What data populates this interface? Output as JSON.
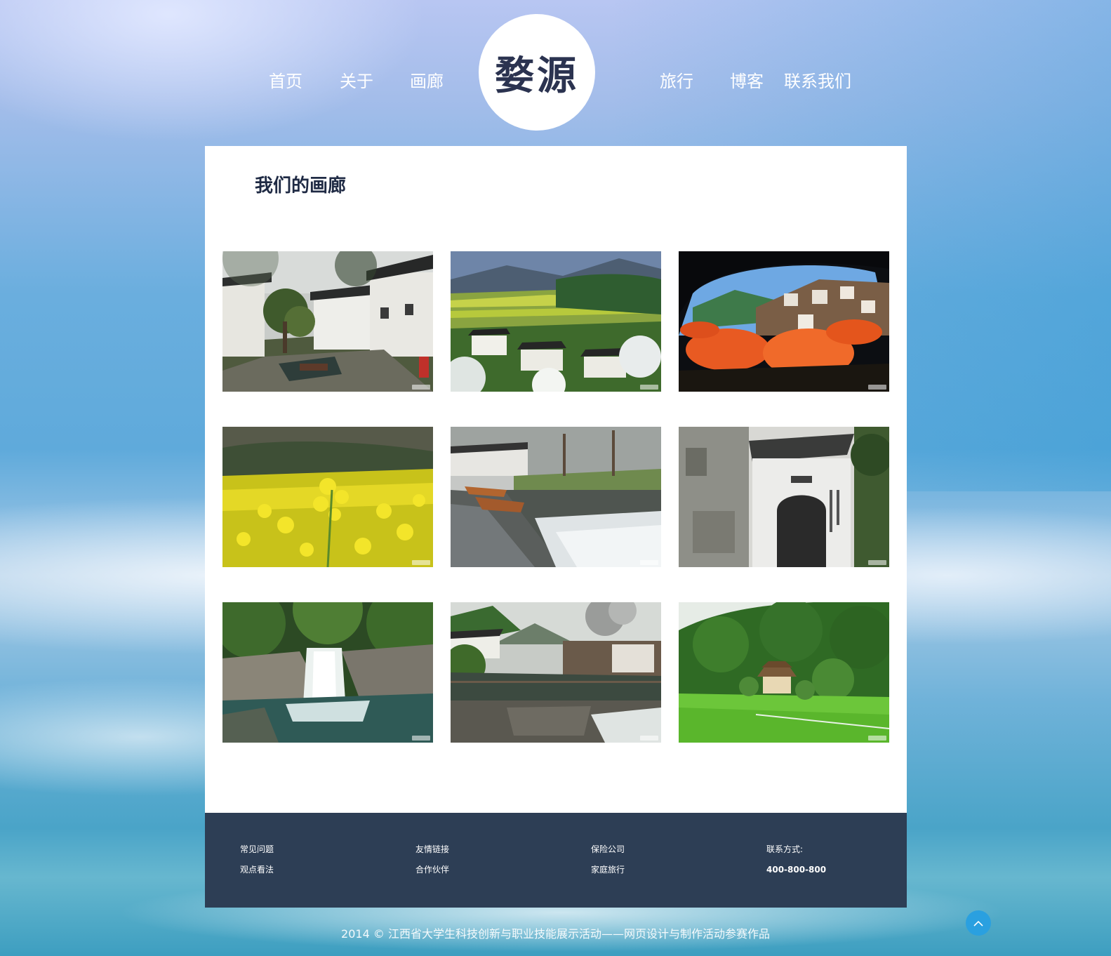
{
  "header": {
    "nav_left": [
      "首页",
      "关于",
      "画廊"
    ],
    "logo": "婺源",
    "nav_right": [
      "旅行",
      "博客",
      "联系我们"
    ]
  },
  "main": {
    "title": "我们的画廊",
    "photos": [
      "village-street-photo",
      "terraced-fields-photo",
      "drying-chili-baskets-photo",
      "rapeseed-flowers-photo",
      "river-boats-photo",
      "ancient-gate-photo",
      "waterfall-photo",
      "riverside-village-photo",
      "mountain-temple-photo"
    ]
  },
  "footer": {
    "col1": [
      "常见问题",
      "观点看法"
    ],
    "col2": [
      "友情链接",
      "合作伙伴"
    ],
    "col3": [
      "保险公司",
      "家庭旅行"
    ],
    "contact_label": "联系方式:",
    "phone": "400-800-800"
  },
  "copyright": "2014 © 江西省大学生科技创新与职业技能展示活动——网页设计与制作活动参赛作品",
  "colors": {
    "footer_bg": "#2d3e55",
    "title": "#1f2a44",
    "back_to_top": "#2aa0e0"
  }
}
